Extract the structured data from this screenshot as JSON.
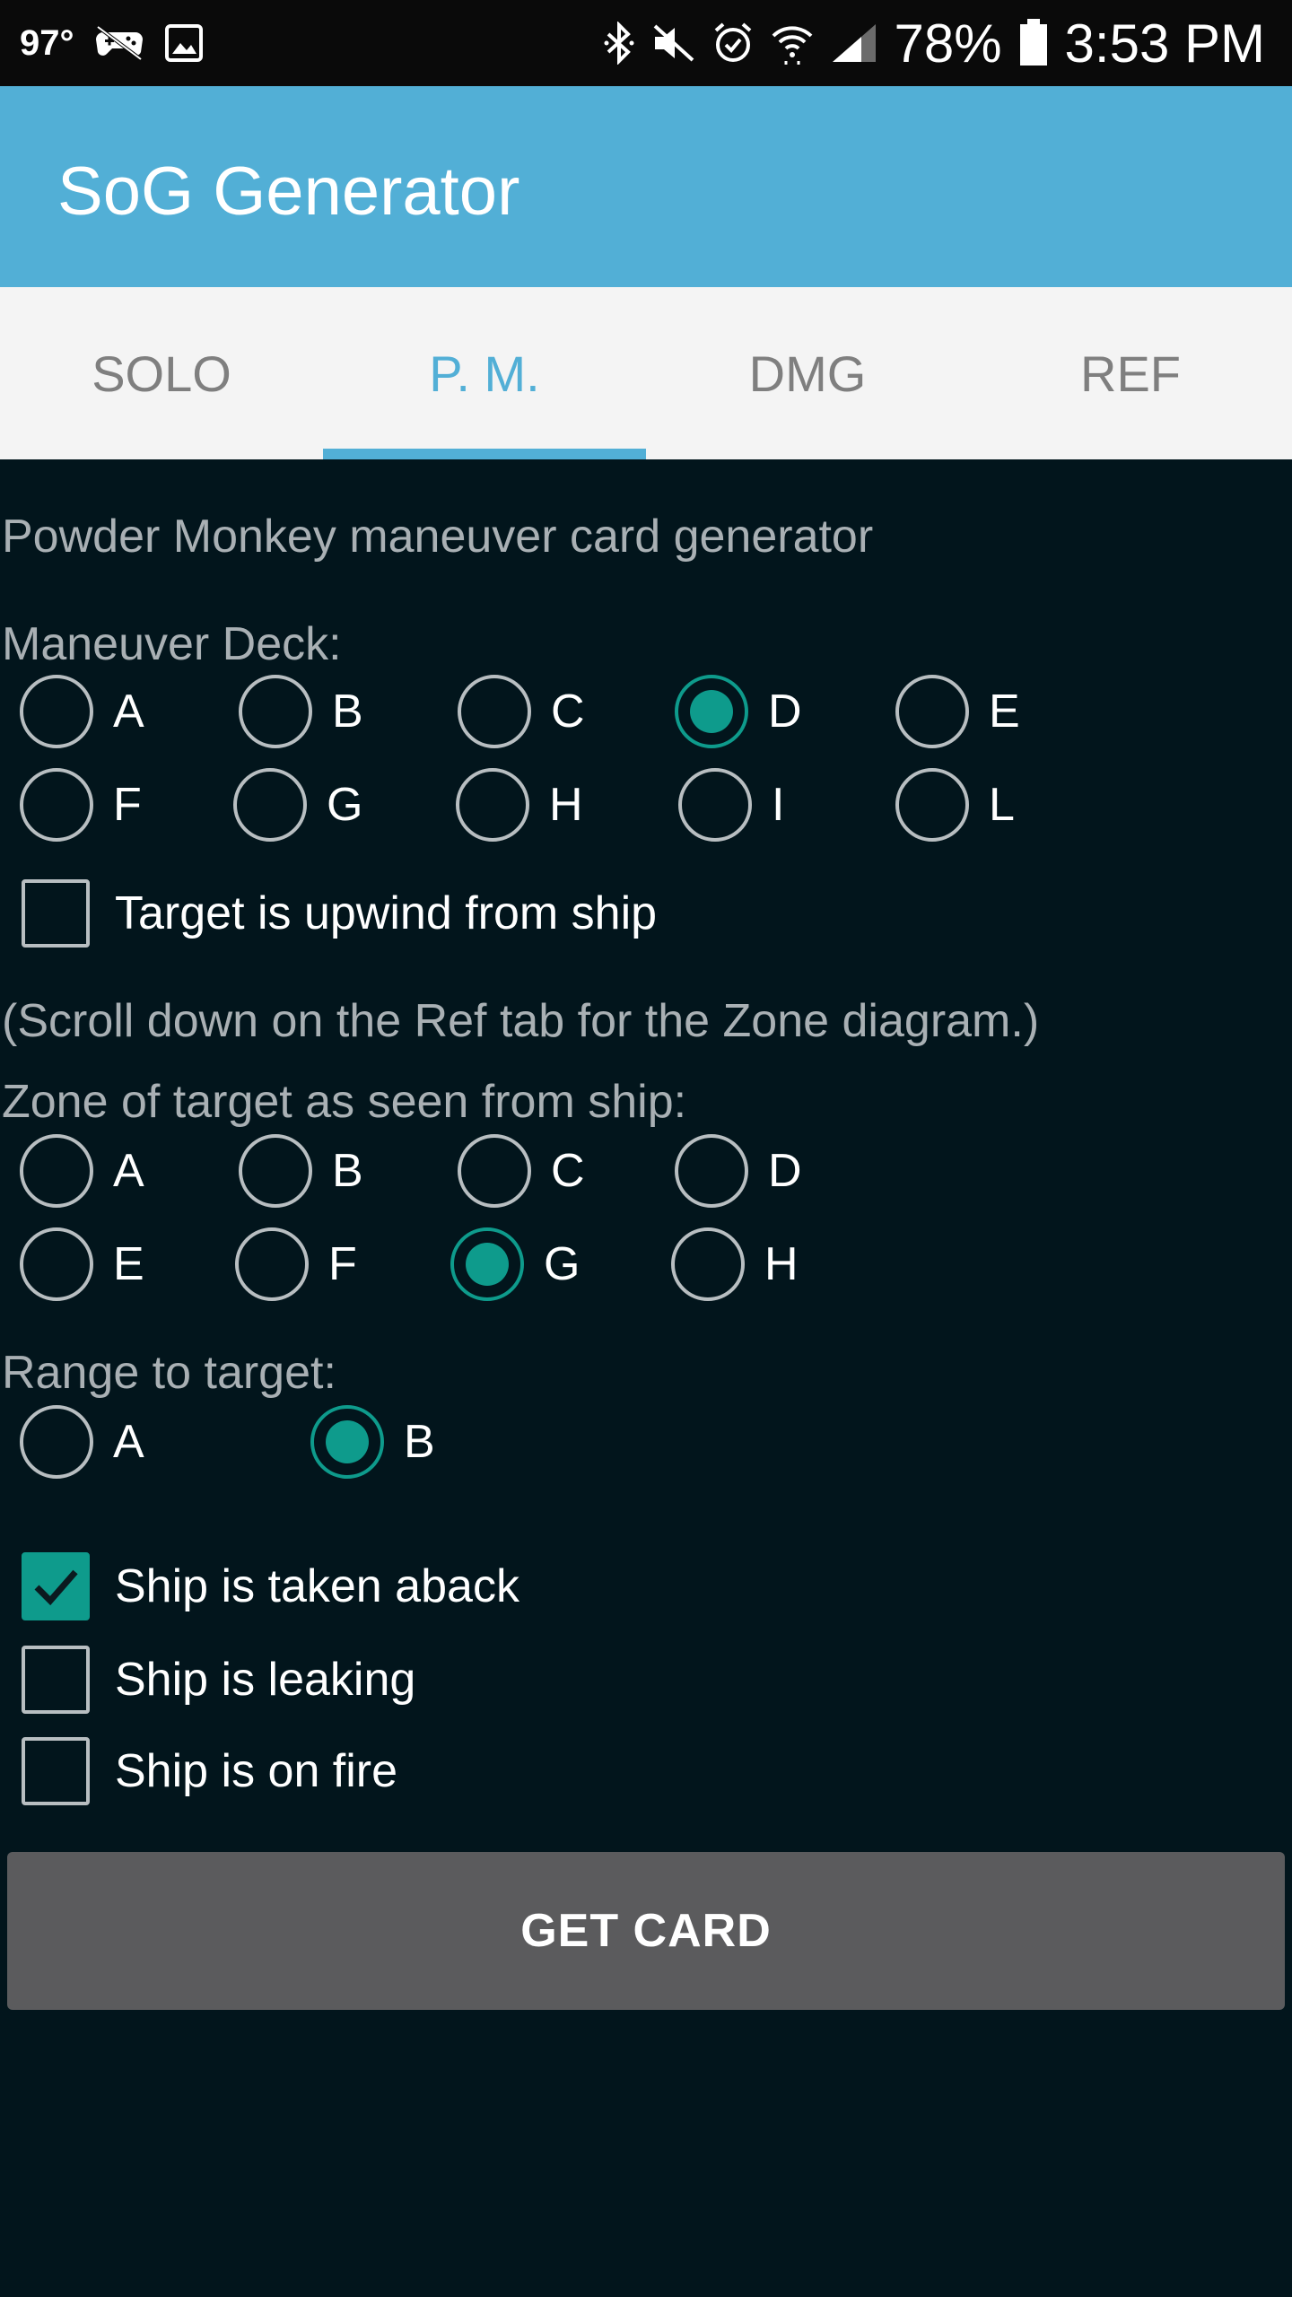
{
  "status_bar": {
    "temperature": "97°",
    "battery": "78%",
    "time": "3:53 PM",
    "left_icons": [
      "game-controller-icon",
      "image-icon"
    ],
    "right_icons": [
      "bluetooth-icon",
      "mute-icon",
      "alarm-icon",
      "wifi-icon",
      "signal-icon",
      "battery-icon"
    ]
  },
  "app_bar": {
    "title": "SoG Generator",
    "color": "#52afd6"
  },
  "tabs": [
    {
      "label": "SOLO",
      "active": false
    },
    {
      "label": "P. M.",
      "active": true
    },
    {
      "label": "DMG",
      "active": false
    },
    {
      "label": "REF",
      "active": false
    }
  ],
  "content": {
    "description": "Powder Monkey maneuver card generator",
    "maneuver_deck": {
      "label": "Maneuver Deck:",
      "options": [
        "A",
        "B",
        "C",
        "D",
        "E",
        "F",
        "G",
        "H",
        "I",
        "L"
      ],
      "selected": "D"
    },
    "upwind_checkbox": {
      "label": "Target is upwind from ship",
      "checked": false
    },
    "scroll_hint": "(Scroll down on the Ref tab for the Zone diagram.)",
    "zone": {
      "label": "Zone of target as seen from ship:",
      "options": [
        "A",
        "B",
        "C",
        "D",
        "E",
        "F",
        "G",
        "H"
      ],
      "selected": "G"
    },
    "range": {
      "label": "Range to target:",
      "options": [
        "A",
        "B"
      ],
      "selected": "B"
    },
    "status_checkboxes": [
      {
        "label": "Ship is taken aback",
        "checked": true
      },
      {
        "label": "Ship is leaking",
        "checked": false
      },
      {
        "label": "Ship is on fire",
        "checked": false
      }
    ],
    "get_card_label": "GET CARD"
  },
  "colors": {
    "accent": "#0e9b8c",
    "background": "#02151c"
  }
}
